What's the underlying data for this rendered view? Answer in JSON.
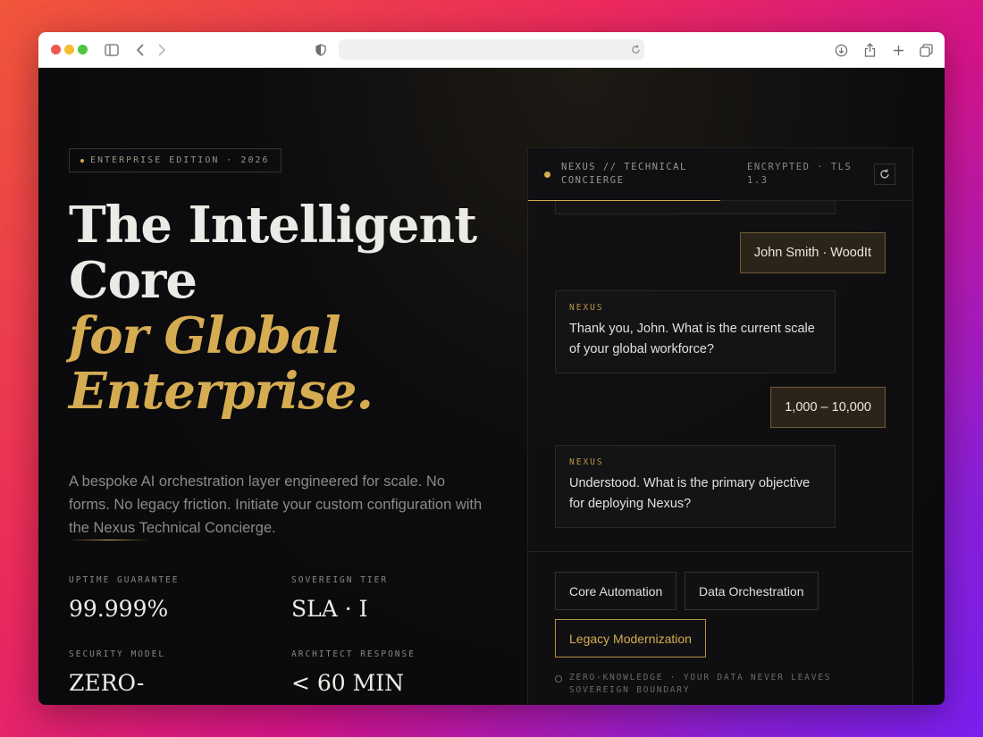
{
  "badge": {
    "text": "ENTERPRISE EDITION · 2026"
  },
  "headline": {
    "line1": "The Intelligent",
    "line2": "Core",
    "line3": "for Global",
    "line4": "Enterprise."
  },
  "lede": "A bespoke AI orchestration layer engineered for scale. No forms. No legacy friction. Initiate your custom configuration with the Nexus Technical Concierge.",
  "stats": [
    {
      "label": "UPTIME GUARANTEE",
      "value": "99.999%"
    },
    {
      "label": "SOVEREIGN TIER",
      "value": "SLA · I"
    },
    {
      "label": "SECURITY MODEL",
      "value": "ZERO-"
    },
    {
      "label": "ARCHITECT RESPONSE",
      "value": "< 60 MIN"
    }
  ],
  "chat": {
    "title": "NEXUS // TECHNICAL CONCIERGE",
    "encryption": "ENCRYPTED · TLS 1.3",
    "messages": [
      {
        "role": "user",
        "text": "John Smith · WoodIt"
      },
      {
        "role": "bot",
        "who": "NEXUS",
        "text": "Thank you, John. What is the current scale of your global workforce?"
      },
      {
        "role": "user",
        "text": "1,000 – 10,000"
      },
      {
        "role": "bot",
        "who": "NEXUS",
        "text": "Understood. What is the primary objective for deploying Nexus?"
      }
    ],
    "options": [
      "Core Automation",
      "Data Orchestration",
      "Legacy Modernization"
    ],
    "selected_option": "Legacy Modernization",
    "footer_note": "ZERO-KNOWLEDGE · YOUR DATA NEVER LEAVES SOVEREIGN BOUNDARY"
  },
  "colors": {
    "accent": "#d5ac52",
    "background": "#0b0b0d"
  }
}
